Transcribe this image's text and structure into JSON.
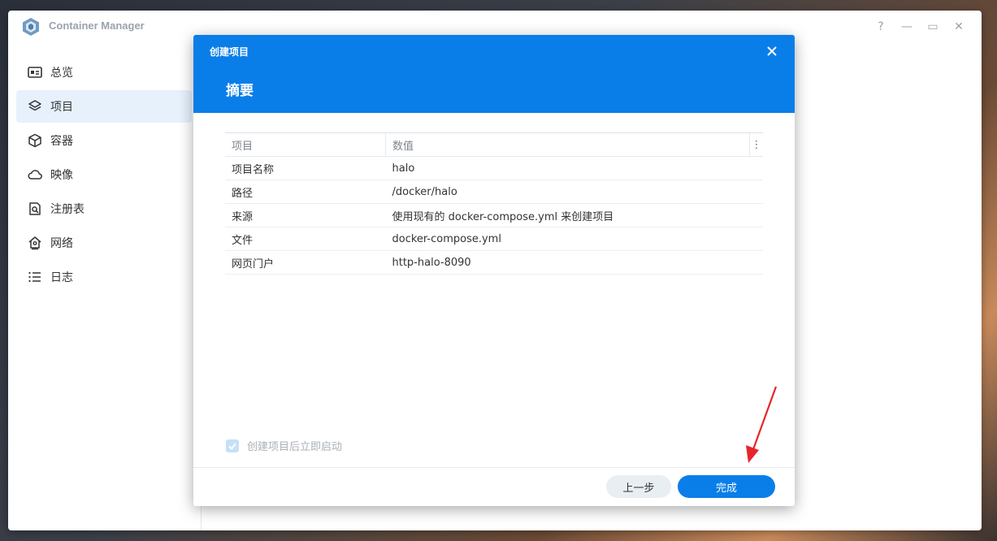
{
  "app": {
    "title": "Container Manager"
  },
  "window_controls": {
    "help": "?",
    "minimize": "—",
    "maximize": "▭",
    "close": "✕"
  },
  "sidebar": {
    "items": [
      {
        "label": "总览",
        "icon": "overview-icon",
        "active": false
      },
      {
        "label": "项目",
        "icon": "layers-icon",
        "active": true
      },
      {
        "label": "容器",
        "icon": "cube-icon",
        "active": false
      },
      {
        "label": "映像",
        "icon": "cloud-icon",
        "active": false
      },
      {
        "label": "注册表",
        "icon": "registry-search-icon",
        "active": false
      },
      {
        "label": "网络",
        "icon": "network-home-icon",
        "active": false
      },
      {
        "label": "日志",
        "icon": "list-icon",
        "active": false
      }
    ]
  },
  "dialog": {
    "title": "创建项目",
    "subtitle": "摘要",
    "table": {
      "columns": [
        "项目",
        "数值"
      ],
      "rows": [
        [
          "项目名称",
          "halo"
        ],
        [
          "路径",
          "/docker/halo"
        ],
        [
          "来源",
          "使用现有的 docker-compose.yml 来创建项目"
        ],
        [
          "文件",
          "docker-compose.yml"
        ],
        [
          "网页门户",
          "http-halo-8090"
        ]
      ]
    },
    "autostart_label": "创建项目后立即启动",
    "autostart_checked": true,
    "back_label": "上一步",
    "finish_label": "完成"
  },
  "colors": {
    "accent": "#0a7ee8",
    "annotation_arrow": "#e8242b"
  }
}
